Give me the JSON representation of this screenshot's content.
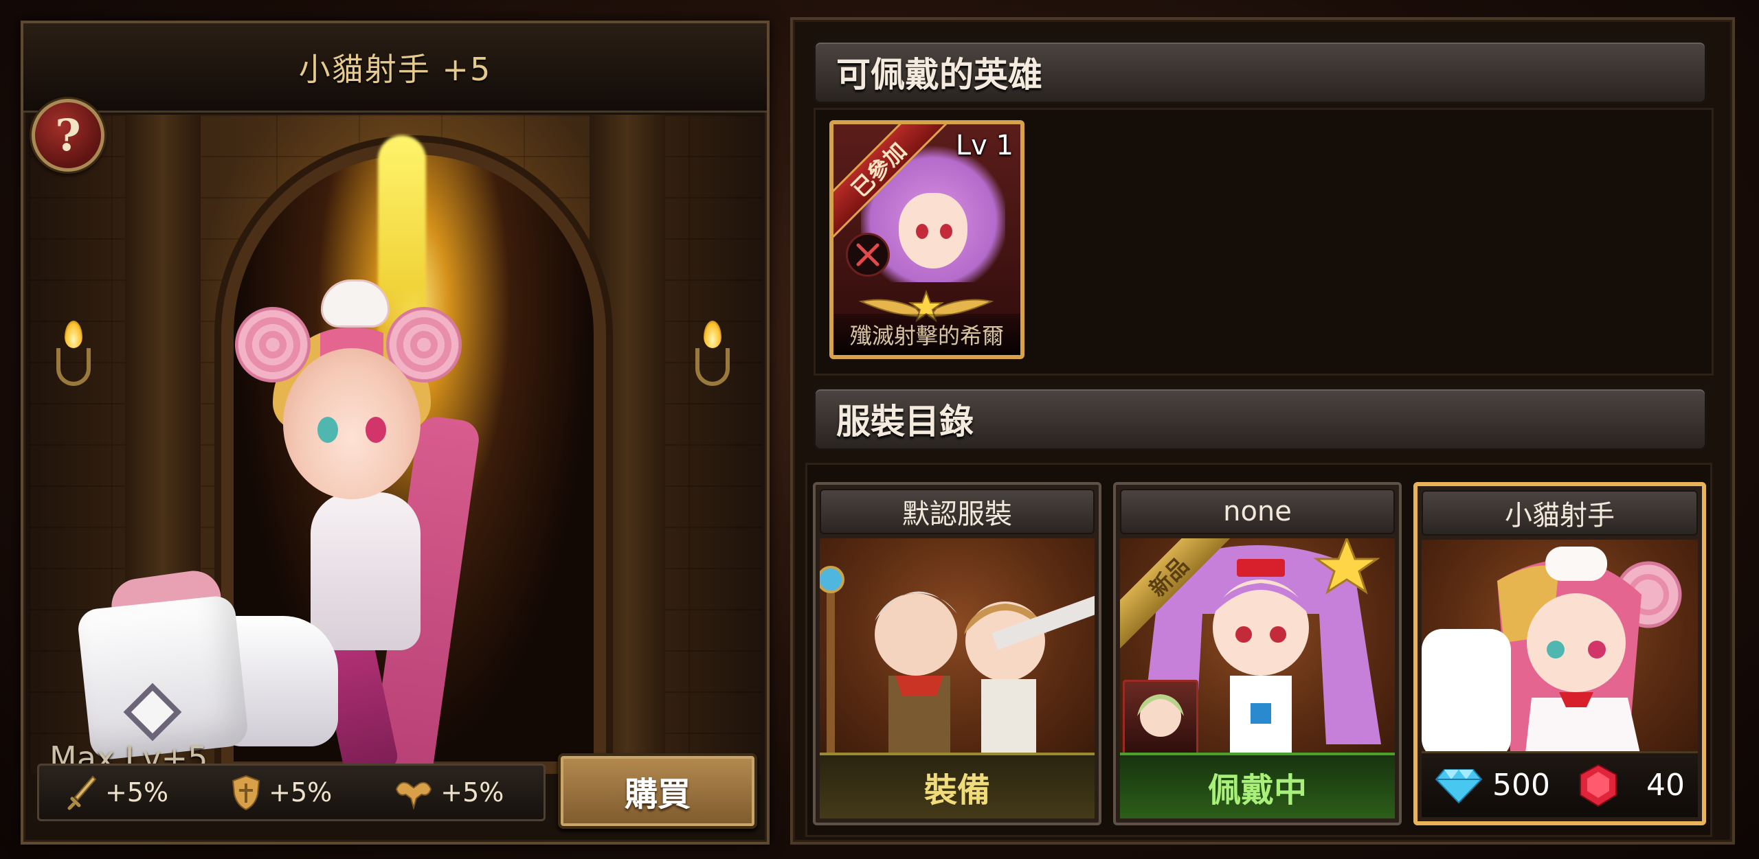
{
  "left_panel": {
    "title": "小貓射手 +5",
    "help_label": "?",
    "max_level": "Max Lv+5",
    "stats": [
      {
        "icon": "sword-icon",
        "value": "+5%"
      },
      {
        "icon": "shield-icon",
        "value": "+5%"
      },
      {
        "icon": "muscle-icon",
        "value": "+5%"
      }
    ],
    "buy_label": "購買"
  },
  "heroes_section": {
    "title": "可佩戴的英雄",
    "heroes": [
      {
        "name": "殲滅射擊的希爾",
        "level": "Lv 1",
        "status": "已參加",
        "class_icon": "crossed-swords-icon"
      }
    ]
  },
  "costume_section": {
    "title": "服裝目錄",
    "costumes": [
      {
        "title": "默認服裝",
        "action": "裝備"
      },
      {
        "title": "none",
        "action": "佩戴中",
        "badge": "新品"
      },
      {
        "title": "小貓射手",
        "price_gems": "500",
        "price_rubies": "40"
      }
    ]
  },
  "colors": {
    "accent_gold": "#e9b35a",
    "equip_text": "#f0dc7a",
    "wearing_text": "#a8f07a",
    "ribbon_red": "#b52a26"
  }
}
